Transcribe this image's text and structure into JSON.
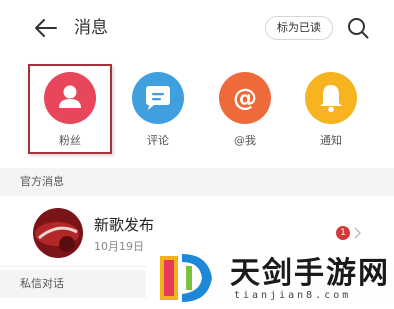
{
  "header": {
    "title": "消息",
    "mark_read_label": "标为已读",
    "back_icon": "arrow-left-icon",
    "search_icon": "search-icon"
  },
  "categories": [
    {
      "label": "粉丝",
      "icon": "person-icon",
      "color": "#e8465a"
    },
    {
      "label": "评论",
      "icon": "chat-bubble-icon",
      "color": "#3f9fdf"
    },
    {
      "label": "@我",
      "icon": "at-sign-icon",
      "color": "#ef6a3b"
    },
    {
      "label": "通知",
      "icon": "bell-icon",
      "color": "#f7b320"
    }
  ],
  "official_section": {
    "header": "官方消息",
    "item": {
      "title": "新歌发布",
      "date": "10月19日",
      "badge": "1"
    }
  },
  "private_section": {
    "header": "私信对话"
  },
  "watermark": {
    "text_cn": "天剑手游网",
    "text_en": "tianjian8.com"
  }
}
